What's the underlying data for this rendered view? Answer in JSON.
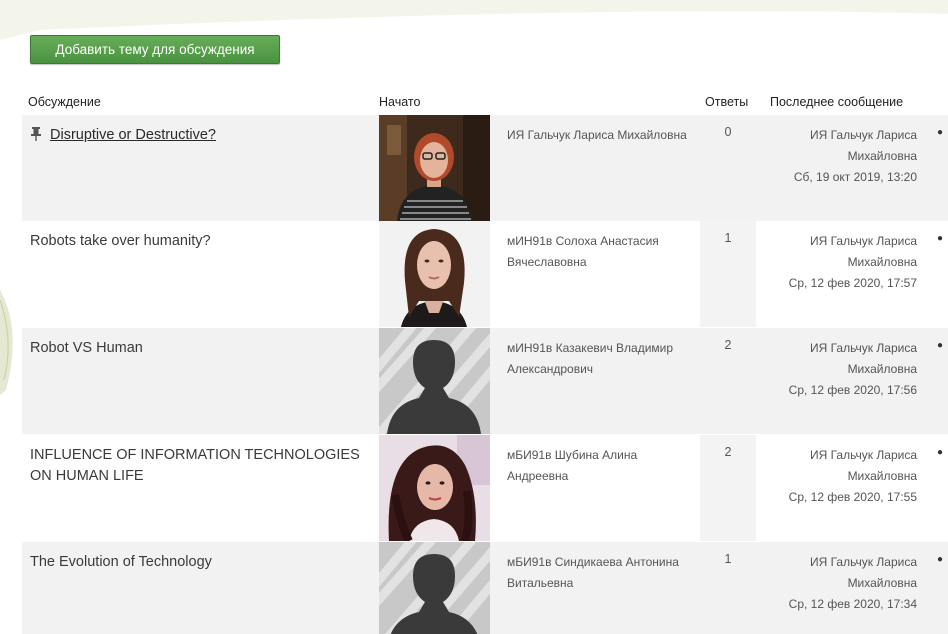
{
  "forum": {
    "add_button_label": "Добавить тему для обсуждения",
    "columns": {
      "discussion": "Обсуждение",
      "started_by": "Начато",
      "replies": "Ответы",
      "last_post": "Последнее сообщение"
    },
    "accent_color": "#55a049",
    "rows": [
      {
        "title": "Disruptive or Destructive?",
        "pinned": true,
        "is_link": true,
        "photo": "woman-glasses-photo",
        "author": "ИЯ Гальчук Лариса Михайловна",
        "replies": "0",
        "last_author": "ИЯ Гальчук Лариса Михайловна",
        "last_date": "Сб, 19 окт 2019, 13:20"
      },
      {
        "title": "Robots take over humanity?",
        "pinned": false,
        "is_link": false,
        "photo": "woman-photo",
        "author": "мИН91в Солоха Анастасия Вячеславовна",
        "replies": "1",
        "last_author": "ИЯ Гальчук Лариса Михайловна",
        "last_date": "Ср, 12 фев 2020, 17:57"
      },
      {
        "title": "Robot VS Human",
        "pinned": false,
        "is_link": false,
        "photo": "default-avatar-silhouette",
        "author": "мИН91в Казакевич Владимир Александрович",
        "replies": "2",
        "last_author": "ИЯ Гальчук Лариса Михайловна",
        "last_date": "Ср, 12 фев 2020, 17:56"
      },
      {
        "title": "INFLUENCE OF INFORMATION TECHNOLOGIES ON HUMAN LIFE",
        "pinned": false,
        "is_link": false,
        "photo": "woman-selfie-photo",
        "author": "мБИ91в Шубина Алина Андреевна",
        "replies": "2",
        "last_author": "ИЯ Гальчук Лариса Михайловна",
        "last_date": "Ср, 12 фев 2020, 17:55"
      },
      {
        "title": "The Evolution of Technology",
        "pinned": false,
        "is_link": false,
        "photo": "default-avatar-silhouette",
        "author": "мБИ91в Синдикаева Антонина Витальевна",
        "replies": "1",
        "last_author": "ИЯ Гальчук Лариса Михайловна",
        "last_date": "Ср, 12 фев 2020, 17:34"
      }
    ]
  }
}
